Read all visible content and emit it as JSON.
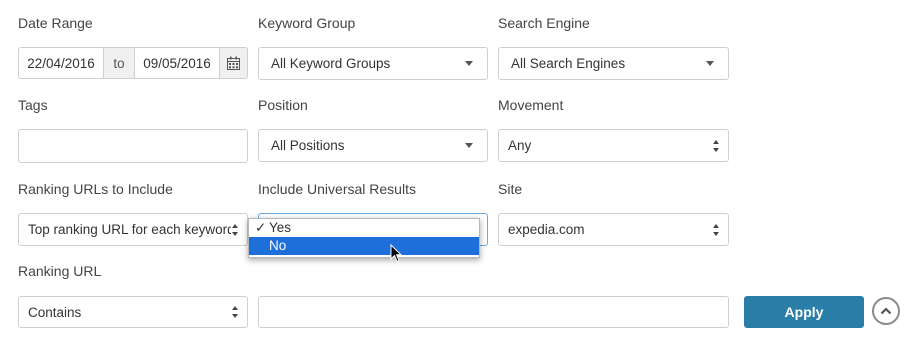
{
  "labels": {
    "date_range": "Date Range",
    "keyword_group": "Keyword Group",
    "search_engine": "Search Engine",
    "tags": "Tags",
    "position": "Position",
    "movement": "Movement",
    "ranking_urls": "Ranking URLs to Include",
    "universal": "Include Universal Results",
    "site": "Site",
    "ranking_url": "Ranking URL"
  },
  "date": {
    "from": "22/04/2016",
    "to_word": "to",
    "until": "09/05/2016",
    "icon": "calendar-icon"
  },
  "values": {
    "keyword_group": "All Keyword Groups",
    "search_engine": "All Search Engines",
    "tags": "",
    "position": "All Positions",
    "movement": "Any",
    "ranking_urls": "Top ranking URL for each keyword",
    "site": "expedia.com",
    "ranking_url_match": "Contains",
    "ranking_url_text": ""
  },
  "universal_dropdown": {
    "options": [
      {
        "label": "Yes",
        "checked": true
      },
      {
        "label": "No",
        "highlighted": true
      }
    ]
  },
  "buttons": {
    "apply": "Apply",
    "collapse_icon": "chevron-up-icon"
  },
  "colors": {
    "accent": "#2a7fa8",
    "highlight": "#1e6fd9"
  }
}
